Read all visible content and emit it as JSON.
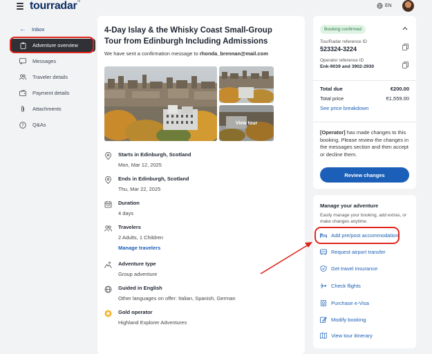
{
  "header": {
    "logo_text": "tourradar",
    "logo_tm": "™",
    "language": "EN",
    "icons": [
      "menu-icon",
      "globe-icon"
    ]
  },
  "sidebar": {
    "back_label": "Inbox",
    "items": [
      {
        "label": "Adventure overview",
        "icon": "clipboard-icon",
        "active": true
      },
      {
        "label": "Messages",
        "icon": "message-icon",
        "active": false
      },
      {
        "label": "Traveler details",
        "icon": "users-icon",
        "active": false
      },
      {
        "label": "Payment details",
        "icon": "wallet-icon",
        "active": false
      },
      {
        "label": "Attachments",
        "icon": "paperclip-icon",
        "active": false
      },
      {
        "label": "Q&As",
        "icon": "question-icon",
        "active": false
      }
    ]
  },
  "main": {
    "title": "4-Day Islay & the Whisky Coast Small-Group Tour from Edinburgh Including Admissions",
    "confirm_prefix": "We have sent a confirmation message to ",
    "confirm_email": "rhonda_brennan@mail.com",
    "view_tour_label": "View tour",
    "details": [
      {
        "icon": "location-pin-icon",
        "label": "Starts in Edinburgh, Scotland",
        "value": "Mon, Mar 12, 2025"
      },
      {
        "icon": "location-pin-icon",
        "label": "Ends in Edinburgh, Scotland",
        "value": "Thu, Mar 22, 2025"
      },
      {
        "icon": "calendar-icon",
        "label": "Duration",
        "value": "4 days"
      },
      {
        "icon": "users-icon",
        "label": "Travelers",
        "value": "2 Adults, 1 Children",
        "link": "Manage travelers"
      },
      {
        "icon": "hiking-icon",
        "label": "Adventure type",
        "value": "Group adventure"
      },
      {
        "icon": "globe-icon",
        "label": "Guided in English",
        "value": "Other languages on offer: Italian, Spanish, German"
      },
      {
        "icon": "gold-badge-icon",
        "label": "Gold operator",
        "value": "Highland Explorer Adventures"
      }
    ]
  },
  "booking": {
    "status_badge": "Booking confirmed",
    "ref_label": "TourRadar reference ID",
    "ref_value": "523324-3224",
    "op_label": "Operator reference ID",
    "op_value": "Enk-9039 and 3902-2930",
    "total_due_label": "Total due",
    "total_due_value": "€200.00",
    "total_price_label": "Total price",
    "total_price_value": "€1,559.00",
    "breakdown_link": "See price breakdown",
    "operator_tag": "[Operator]",
    "operator_note": " has made changes to this booking. Please review the changes in the messages section and then accept or decline them.",
    "review_button": "Review changes"
  },
  "manage": {
    "title": "Manage your adventure",
    "description": "Easily manage your booking, add extras, or make changes anytime.",
    "actions": [
      {
        "label": "Add pre/post accommodation",
        "icon": "bed-icon"
      },
      {
        "label": "Request airport transfer",
        "icon": "bus-icon"
      },
      {
        "label": "Get travel insurance",
        "icon": "shield-icon"
      },
      {
        "label": "Check flights",
        "icon": "plane-icon"
      },
      {
        "label": "Purchase e-Visa",
        "icon": "passport-icon"
      },
      {
        "label": "Modify booking",
        "icon": "edit-icon"
      },
      {
        "label": "View tour itinerary",
        "icon": "map-icon"
      }
    ]
  },
  "colors": {
    "accent": "#1a5fb4",
    "highlight": "#e0241b",
    "active_nav": "#2f3136",
    "badge_bg": "#dff3e4",
    "badge_text": "#2b7a43"
  }
}
